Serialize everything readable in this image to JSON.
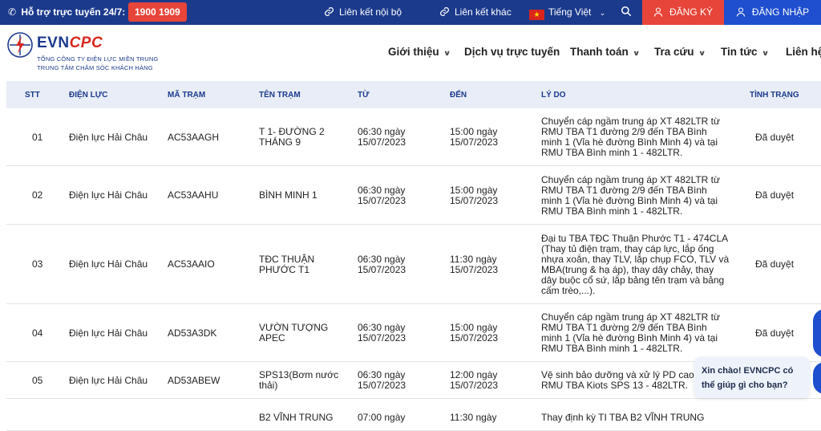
{
  "topbar": {
    "hotline_label": "Hỗ trợ trực tuyến 24/7:",
    "hotline_number": "1900 1909",
    "internal_links": "Liên kết nội bộ",
    "other_links": "Liên kết khác",
    "language": "Tiếng Việt",
    "register": "ĐĂNG KÝ",
    "login": "ĐĂNG NHẬP"
  },
  "logo": {
    "brand_evn": "EVN",
    "brand_cpc": "CPC",
    "sub1": "TỔNG CÔNG TY ĐIỆN LỰC MIỀN TRUNG",
    "sub2": "TRUNG TÂM CHĂM SÓC KHÁCH HÀNG"
  },
  "nav": [
    {
      "label": "Giới thiệu",
      "dropdown": true
    },
    {
      "label": "Dịch vụ trực tuyến",
      "dropdown": false
    },
    {
      "label": "Thanh toán",
      "dropdown": true
    },
    {
      "label": "Tra cứu",
      "dropdown": true
    },
    {
      "label": "Tin tức",
      "dropdown": true
    },
    {
      "label": "Liên hệ",
      "dropdown": false
    }
  ],
  "table": {
    "headers": [
      "STT",
      "ĐIỆN LỰC",
      "MÃ TRẠM",
      "TÊN TRẠM",
      "TỪ",
      "ĐẾN",
      "LÝ DO",
      "TÌNH TRẠNG"
    ],
    "rows": [
      {
        "stt": "01",
        "dien_luc": "Điện lực Hải Châu",
        "ma_tram": "AC53AAGH",
        "ten_tram": [
          "T 1- ĐƯỜNG 2",
          "THÁNG 9"
        ],
        "tu": [
          "06:30 ngày",
          "15/07/2023"
        ],
        "den": [
          "15:00 ngày",
          "15/07/2023"
        ],
        "ly_do": [
          "Chuyển cáp ngầm trung áp XT 482LTR từ",
          "RMU TBA T1 đường 2/9 đến TBA Bình",
          "minh 1 (Vỉa hè đường Bình Minh 4) và tại",
          "RMU TBA Bình minh 1 - 482LTR."
        ],
        "tinh_trang": "Đã duyệt"
      },
      {
        "stt": "02",
        "dien_luc": "Điện lực Hải Châu",
        "ma_tram": "AC53AAHU",
        "ten_tram": [
          "BÌNH MINH 1"
        ],
        "tu": [
          "06:30 ngày",
          "15/07/2023"
        ],
        "den": [
          "15:00 ngày",
          "15/07/2023"
        ],
        "ly_do": [
          "Chuyển cáp ngầm trung áp XT 482LTR từ",
          "RMU TBA T1 đường 2/9 đến TBA Bình",
          "minh 1 (Vỉa hè đường Bình Minh 4) và tại",
          "RMU TBA Bình minh 1 - 482LTR."
        ],
        "tinh_trang": "Đã duyệt"
      },
      {
        "stt": "03",
        "dien_luc": "Điện lực Hải Châu",
        "ma_tram": "AC53AAIO",
        "ten_tram": [
          "TĐC THUẬN",
          "PHƯỚC T1"
        ],
        "tu": [
          "06:30 ngày",
          "15/07/2023"
        ],
        "den": [
          "11:30 ngày",
          "15/07/2023"
        ],
        "ly_do": [
          "Đại tu TBA TĐC Thuận Phước T1 - 474CLA",
          "(Thay tủ điện trạm, thay cáp lực, lắp ống",
          "nhựa xoắn, thay TLV, lắp chụp FCO, TLV và",
          "MBA(trung & hạ áp), thay dây chảy, thay",
          "dây buộc cổ sứ, lắp bảng tên trạm và bảng",
          "cấm trèo,...)."
        ],
        "tinh_trang": "Đã duyệt"
      },
      {
        "stt": "04",
        "dien_luc": "Điện lực Hải Châu",
        "ma_tram": "AD53A3DK",
        "ten_tram": [
          "VƯỜN TƯỢNG",
          "APEC"
        ],
        "tu": [
          "06:30 ngày",
          "15/07/2023"
        ],
        "den": [
          "15:00 ngày",
          "15/07/2023"
        ],
        "ly_do": [
          "Chuyển cáp ngầm trung áp XT 482LTR từ",
          "RMU TBA T1 đường 2/9 đến TBA Bình",
          "minh 1 (Vỉa hè đường Bình Minh 4) và tại",
          "RMU TBA Bình minh 1 - 482LTR."
        ],
        "tinh_trang": "Đã duyệt"
      },
      {
        "stt": "05",
        "dien_luc": "Điện lực Hải Châu",
        "ma_tram": "AD53ABEW",
        "ten_tram": [
          "SPS13(Bơm nước",
          "thải)"
        ],
        "tu": [
          "06:30 ngày",
          "15/07/2023"
        ],
        "den": [
          "12:00 ngày",
          "15/07/2023"
        ],
        "ly_do": [
          "Vệ sinh bảo dưỡng và xử lý PD cao tủ",
          "RMU TBA Kiots SPS 13 - 482LTR."
        ],
        "tinh_trang": ""
      },
      {
        "stt": "",
        "dien_luc": "",
        "ma_tram": "",
        "ten_tram": [
          "B2 VĨNH TRUNG"
        ],
        "tu": [
          "07:00 ngày"
        ],
        "den": [
          "11:30 ngày"
        ],
        "ly_do": [
          "Thay định kỳ TI TBA B2 VĨNH TRUNG"
        ],
        "tinh_trang": ""
      }
    ]
  },
  "chat": {
    "greeting_line1": "Xin chào! EVNCPC có",
    "greeting_line2": "thể giúp gì cho bạn?"
  },
  "colors": {
    "topbar_bg": "#1b3a8c",
    "hotline_bg": "#e7453a",
    "register_bg": "#e7453a",
    "login_bg": "#1f4fcf",
    "header_row_bg": "#e8edf7",
    "header_text": "#1b3a8c"
  }
}
